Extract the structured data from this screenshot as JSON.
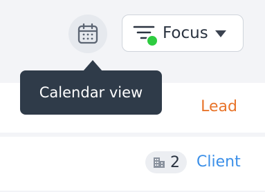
{
  "header": {
    "calendar_button_icon": "calendar-icon",
    "focus_button": {
      "label": "Focus",
      "icon": "filter-icon",
      "status_dot_color": "#2ecc40"
    },
    "tooltip": "Calendar view"
  },
  "rows": [
    {
      "tag": "Lead",
      "tag_color": "#e8742a"
    },
    {
      "company_count": "2",
      "company_icon": "building-icon",
      "tag": "Client",
      "tag_color": "#3b8fe8"
    }
  ]
}
